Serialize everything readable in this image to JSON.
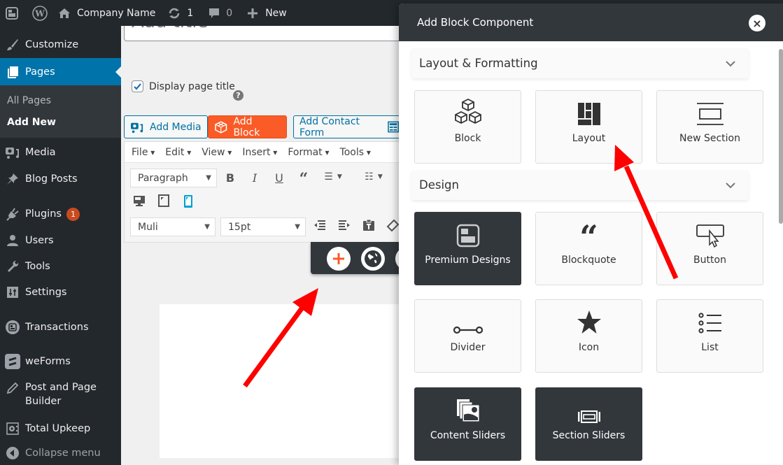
{
  "adminbar": {
    "site_name": "Company Name",
    "updates_count": "1",
    "comments_count": "0",
    "new_label": "New"
  },
  "sidebar": {
    "items": [
      {
        "label": "Customize",
        "icon": "brush-icon"
      },
      {
        "label": "Pages",
        "icon": "pages-icon",
        "active": true
      },
      {
        "label": "Media",
        "icon": "media-icon"
      },
      {
        "label": "Blog Posts",
        "icon": "pin-icon"
      },
      {
        "label": "Plugins",
        "icon": "plugin-icon",
        "badge": "1"
      },
      {
        "label": "Users",
        "icon": "user-icon"
      },
      {
        "label": "Tools",
        "icon": "wrench-icon"
      },
      {
        "label": "Settings",
        "icon": "settings-icon"
      },
      {
        "label": "Transactions",
        "icon": "transactions-icon"
      },
      {
        "label": "weForms",
        "icon": "weforms-icon"
      },
      {
        "label": "Post and Page Builder",
        "icon": "pencil-icon"
      },
      {
        "label": "Total Upkeep",
        "icon": "safe-icon"
      },
      {
        "label": "Collapse menu",
        "icon": "collapse-icon"
      }
    ],
    "submenu": [
      {
        "label": "All Pages"
      },
      {
        "label": "Add New",
        "current": true
      }
    ]
  },
  "editor": {
    "title_placeholder": "Add title",
    "display_title_label": "Display page title",
    "display_title_checked": true,
    "help": "?",
    "buttons": {
      "add_media": "Add Media",
      "add_block": "Add Block",
      "add_contact_form": "Add Contact Form"
    },
    "menubar": [
      "File",
      "Edit",
      "View",
      "Insert",
      "Format",
      "Tools"
    ],
    "format_select": "Paragraph",
    "font_select": "Muli",
    "size_select": "15pt"
  },
  "panel": {
    "title": "Add Block Component",
    "close": "×",
    "sections": [
      {
        "title": "Layout & Formatting",
        "tiles": [
          {
            "label": "Block",
            "icon": "cubes-icon"
          },
          {
            "label": "Layout",
            "icon": "layout-grid-icon"
          },
          {
            "label": "New Section",
            "icon": "section-icon"
          }
        ]
      },
      {
        "title": "Design",
        "tiles": [
          {
            "label": "Premium Designs",
            "icon": "premium-designs-icon",
            "dark": true
          },
          {
            "label": "Blockquote",
            "icon": "quote-icon"
          },
          {
            "label": "Button",
            "icon": "button-cursor-icon"
          },
          {
            "label": "Divider",
            "icon": "divider-icon"
          },
          {
            "label": "Icon",
            "icon": "star-icon"
          },
          {
            "label": "List",
            "icon": "list-icon"
          },
          {
            "label": "Content Sliders",
            "icon": "content-sliders-icon",
            "dark": true
          },
          {
            "label": "Section Sliders",
            "icon": "section-sliders-icon",
            "dark": true
          }
        ]
      }
    ]
  },
  "colors": {
    "admin_dark": "#23282d",
    "wp_blue": "#0073aa",
    "add_block_orange": "#fb5b27",
    "panel_dark": "#32373c",
    "badge": "#ca4a1f",
    "annotation_red": "#ff0000"
  }
}
